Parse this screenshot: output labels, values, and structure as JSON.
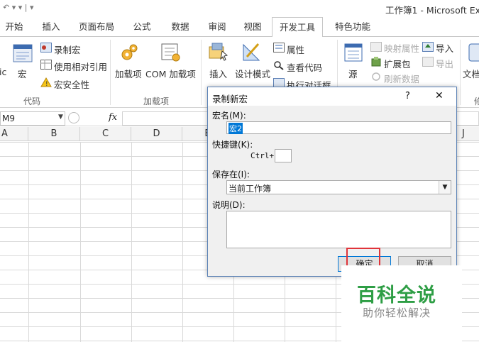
{
  "window": {
    "title": "工作簿1 - Microsoft Ex"
  },
  "tabs": [
    "开始",
    "插入",
    "页面布局",
    "公式",
    "数据",
    "审阅",
    "视图",
    "开发工具",
    "特色功能"
  ],
  "ribbon": {
    "left_cut": "ic",
    "macro": "宏",
    "record_macro": "录制宏",
    "relative_ref": "使用相对引用",
    "macro_security": "宏安全性",
    "group_code": "代码",
    "addins": "加载项",
    "com_addins": "COM 加载项",
    "group_addins": "加载项",
    "insert": "插入",
    "design_mode": "设计模式",
    "properties": "属性",
    "view_code": "查看代码",
    "run_dialog": "执行对话框",
    "source": "源",
    "map_props": "映射属性",
    "expansion": "扩展包",
    "refresh": "刷新数据",
    "import": "导入",
    "export": "导出",
    "doc_cut": "文档",
    "modify_cut": "修"
  },
  "formula_bar": {
    "name_box": "M9",
    "fx": "fx"
  },
  "columns": [
    "A",
    "B",
    "C",
    "D",
    "E",
    "",
    "",
    "",
    "",
    "J"
  ],
  "dialog": {
    "title": "录制新宏",
    "help": "?",
    "close": "✕",
    "macro_name_label": "宏名(M):",
    "macro_name_value": "宏2",
    "shortcut_label": "快捷键(K):",
    "ctrl": "Ctrl+",
    "store_label": "保存在(I):",
    "store_value": "当前工作簿",
    "desc_label": "说明(D):",
    "ok": "确定",
    "cancel": "取消"
  },
  "watermark": {
    "title": "百科全说",
    "subtitle": "助你轻松解决"
  }
}
